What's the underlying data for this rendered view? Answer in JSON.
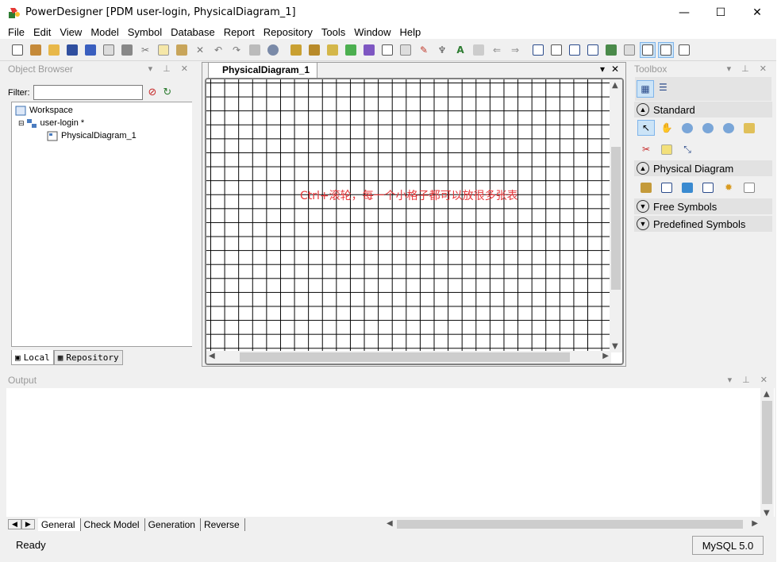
{
  "window": {
    "title": "PowerDesigner [PDM user-login, PhysicalDiagram_1]",
    "minimize": "—",
    "maximize": "☐",
    "close": "✕"
  },
  "menu": [
    "File",
    "Edit",
    "View",
    "Model",
    "Symbol",
    "Database",
    "Report",
    "Repository",
    "Tools",
    "Window",
    "Help"
  ],
  "toolbar_icons": [
    "new-icon",
    "open-package-icon",
    "open-folder-icon",
    "save-icon",
    "save-all-icon",
    "print-preview-icon",
    "print-icon",
    "cut-icon",
    "copy-icon",
    "paste-icon",
    "delete-icon",
    "undo-icon",
    "redo-icon",
    "properties-icon",
    "check-model-icon",
    "generate-database-icon",
    "reverse-engineer-icon",
    "impact-analysis-icon",
    "refresh-icon",
    "check-icon",
    "shadow-icon",
    "grid-icon",
    "brush-icon",
    "format-icon",
    "text-icon",
    "import-icon",
    "export-left-icon",
    "export-right-icon",
    "view-1-icon",
    "view-2-icon",
    "view-3-icon",
    "view-4-icon",
    "view-5-icon",
    "view-6-icon",
    "view-7-icon",
    "view-8-icon"
  ],
  "object_browser": {
    "title": "Object Browser",
    "filter_label": "Filter:",
    "filter_value": "",
    "tree": [
      {
        "label": "Workspace",
        "icon": "workspace-icon"
      },
      {
        "label": "user-login *",
        "icon": "model-icon"
      },
      {
        "label": "PhysicalDiagram_1",
        "icon": "diagram-icon"
      }
    ],
    "tabs": [
      "Local",
      "Repository"
    ]
  },
  "diagram": {
    "tab_label": "PhysicalDiagram_1",
    "annotation": "Ctrl+滚轮，每一个小格子都可以放很多张表"
  },
  "toolbox": {
    "title": "Toolbox",
    "sections": [
      {
        "label": "Standard",
        "expanded": true
      },
      {
        "label": "Physical Diagram",
        "expanded": true
      },
      {
        "label": "Free Symbols",
        "expanded": false
      },
      {
        "label": "Predefined Symbols",
        "expanded": false
      }
    ]
  },
  "output": {
    "title": "Output",
    "tabs": [
      "General",
      "Check Model",
      "Generation",
      "Reverse"
    ]
  },
  "status": {
    "text": "Ready",
    "dbms": "MySQL 5.0"
  }
}
